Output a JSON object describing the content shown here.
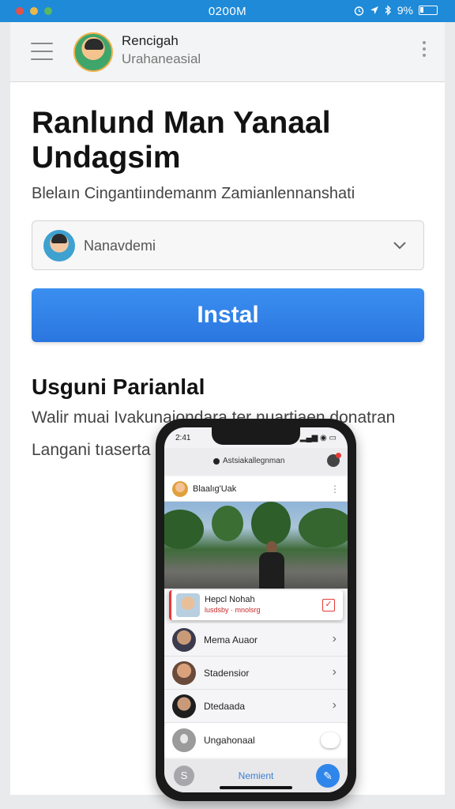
{
  "status_bar": {
    "time": "0200M",
    "right_text": "9%",
    "icons": [
      "alarm-icon",
      "location-icon",
      "bluetooth-icon",
      "battery-icon"
    ],
    "traffic_colors": [
      "#e0524a",
      "#e8b84a",
      "#59b861"
    ]
  },
  "header": {
    "name": "Rencigah",
    "subtitle": "Urahaneasial"
  },
  "main": {
    "title": "Ranlund Man Yanaal Undagsim",
    "subtitle": "Blelaın Cingantiındemanm Zamianlennanshati",
    "select_value": "Nanavdemi",
    "install_label": "Instal",
    "section_title": "Usguni Parianlal",
    "section_text_1": "Walir muai Ivakunaiondara ter nuartiaen donatran",
    "section_text_2": "Langani tıaserta"
  },
  "phone": {
    "time": "2:41",
    "signal": "▂▄▆ ◉ ▭",
    "top_label": "Astsiakallegnman",
    "header_name": "Blaalıg'Uak",
    "card": {
      "name": "Hepcl Nohah",
      "sub": "lusdsby · mnolsrg"
    },
    "list": [
      {
        "name": "Mema Auaor"
      },
      {
        "name": "Stadensior"
      },
      {
        "name": "Dtedaada"
      }
    ],
    "toggle_label": "Ungahonaal",
    "bottom_label": "Nemient",
    "bottom_left_icon": "S",
    "bottom_right_icon": "✎"
  },
  "colors": {
    "accent": "#2f80e8",
    "statusbar": "#1f8ad8",
    "alert": "#e53935"
  }
}
